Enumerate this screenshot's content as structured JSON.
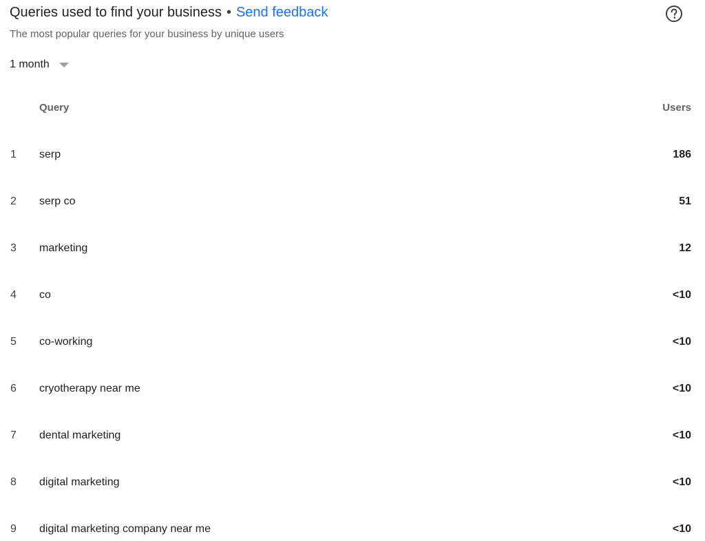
{
  "header": {
    "title": "Queries used to find your business",
    "separator": "•",
    "feedback_link": "Send feedback",
    "help_icon": "help-circle-icon"
  },
  "subtitle": "The most popular queries for your business by unique users",
  "period_selector": {
    "selected": "1 month",
    "icon": "caret-down-icon"
  },
  "table": {
    "columns": {
      "query": "Query",
      "users": "Users"
    },
    "rows": [
      {
        "rank": "1",
        "query": "serp",
        "users": "186"
      },
      {
        "rank": "2",
        "query": "serp co",
        "users": "51"
      },
      {
        "rank": "3",
        "query": "marketing",
        "users": "12"
      },
      {
        "rank": "4",
        "query": "co",
        "users": "<10"
      },
      {
        "rank": "5",
        "query": "co-working",
        "users": "<10"
      },
      {
        "rank": "6",
        "query": "cryotherapy near me",
        "users": "<10"
      },
      {
        "rank": "7",
        "query": "dental marketing",
        "users": "<10"
      },
      {
        "rank": "8",
        "query": "digital marketing",
        "users": "<10"
      },
      {
        "rank": "9",
        "query": "digital marketing company near me",
        "users": "<10"
      }
    ]
  },
  "colors": {
    "link": "#1a73e8",
    "text_primary": "#202124",
    "text_secondary": "#5f6368"
  }
}
